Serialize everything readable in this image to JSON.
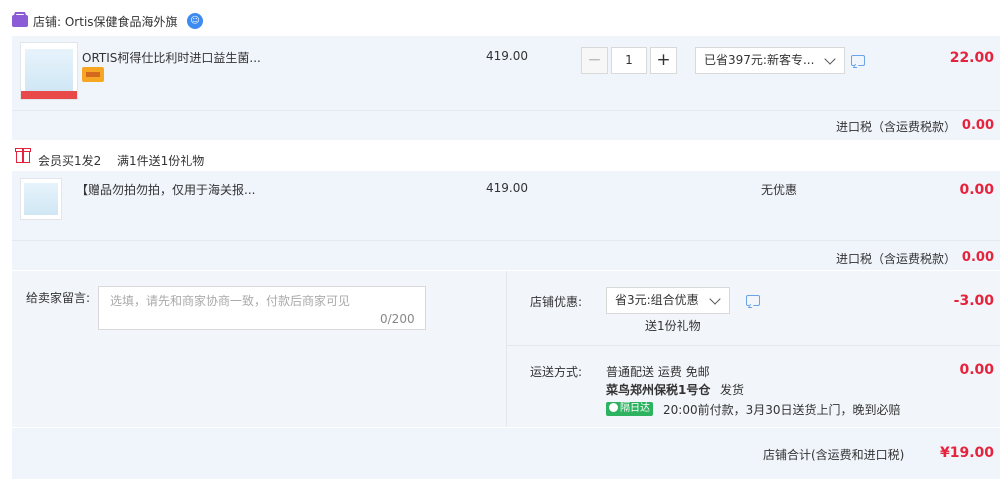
{
  "shop": {
    "label": "店铺: Ortis保健食品海外旗",
    "ww_icon": "wangwang-chat-icon"
  },
  "item1": {
    "title": "ORTIS柯得仕比利时进口益生菌...",
    "price": "419.00",
    "quantity": "1",
    "promo_select": "已省397元:新客专...",
    "amount": "22.00",
    "tax_label": "进口税（含运费税款）",
    "tax_value": "0.00"
  },
  "gift_section": {
    "label": "会员买1发2",
    "desc": "满1件送1份礼物"
  },
  "item2": {
    "title": "【赠品勿拍勿拍，仅用于海关报...",
    "price": "419.00",
    "promo": "无优惠",
    "amount": "0.00",
    "tax_label": "进口税（含运费税款）",
    "tax_value": "0.00"
  },
  "message": {
    "label": "给卖家留言:",
    "placeholder": "选填，请先和商家协商一致，付款后商家可见",
    "count": "0/200"
  },
  "shop_discount": {
    "label": "店铺优惠:",
    "select": "省3元:组合优惠",
    "gift_note": "送1份礼物",
    "amount": "-3.00"
  },
  "shipping": {
    "label": "运送方式:",
    "method": "普通配送 运费 免邮",
    "warehouse": "菜鸟郑州保税1号仓",
    "dispatch": "发货",
    "badge": "隔日达",
    "note": "20:00前付款，3月30日送货上门，晚到必赔",
    "amount": "0.00"
  },
  "total": {
    "label": "店铺合计(含运费和进口税)",
    "value": "¥19.00"
  },
  "colors": {
    "accent_red": "#e6233c",
    "panel_bg": "#f0f4fb",
    "badge_green": "#2db35f"
  }
}
